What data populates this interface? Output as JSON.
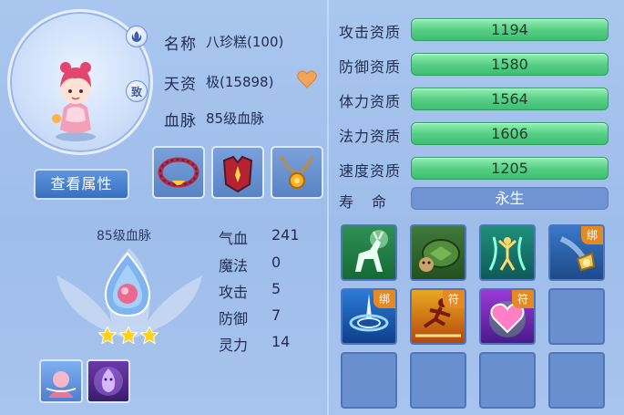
{
  "pet": {
    "name_label": "名称",
    "name_value": "八珍糕(100)",
    "aptitude_label": "天资",
    "aptitude_value": "极(15898)",
    "bloodline_label": "血脉",
    "bloodline_value": "85级血脉",
    "badge_text": "致"
  },
  "buttons": {
    "view_attributes": "查看属性"
  },
  "bloodline_panel": {
    "title": "85级血脉",
    "stars": 3,
    "stats": [
      {
        "name": "气血",
        "value": "241"
      },
      {
        "name": "魔法",
        "value": "0"
      },
      {
        "name": "攻击",
        "value": "5"
      },
      {
        "name": "防御",
        "value": "7"
      },
      {
        "name": "灵力",
        "value": "14"
      }
    ]
  },
  "aptitudes": [
    {
      "label": "攻击资质",
      "value": "1194"
    },
    {
      "label": "防御资质",
      "value": "1580"
    },
    {
      "label": "体力资质",
      "value": "1564"
    },
    {
      "label": "法力资质",
      "value": "1606"
    },
    {
      "label": "速度资质",
      "value": "1205"
    }
  ],
  "lifespan": {
    "label": "寿命",
    "value": "永生"
  },
  "skills": [
    {
      "icon": "deer-skill-icon",
      "tag": ""
    },
    {
      "icon": "turtle-skill-icon",
      "tag": ""
    },
    {
      "icon": "dance-skill-icon",
      "tag": ""
    },
    {
      "icon": "lamp-skill-icon",
      "tag": "绑"
    },
    {
      "icon": "vortex-skill-icon",
      "tag": "绑"
    },
    {
      "icon": "runner-skill-icon",
      "tag": "符"
    },
    {
      "icon": "heart-skill-icon",
      "tag": "符"
    }
  ],
  "colors": {
    "bar_green": "#58cf86",
    "life_bar": "#6f93d3",
    "tag_orange": "#e48a22",
    "button_blue": "#3a6fc0"
  }
}
